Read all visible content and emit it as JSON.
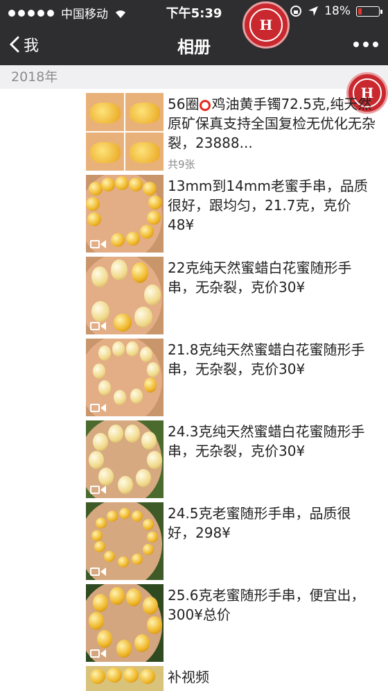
{
  "status": {
    "carrier": "中国移动",
    "time": "下午5:39",
    "battery": "18%",
    "battery_level": 0.18
  },
  "nav": {
    "back_label": "我",
    "title": "相册"
  },
  "logo_text": "H",
  "section": {
    "year": "2018年"
  },
  "entries": [
    {
      "text_a": "56圈",
      "text_b": "鸡油黄手镯72.5克,纯天然原矿保真支持全国复检无优化无杂裂，23888...",
      "count": "共9张"
    },
    {
      "text": "13mm到14mm老蜜手串，品质很好，跟均匀，21.7克，克价48¥"
    },
    {
      "text": "22克纯天然蜜蜡白花蜜随形手串，无杂裂，克价30¥"
    },
    {
      "text": "21.8克纯天然蜜蜡白花蜜随形手串，无杂裂，克价30¥"
    },
    {
      "text": "24.3克纯天然蜜蜡白花蜜随形手串，无杂裂，克价30¥"
    },
    {
      "text": "24.5克老蜜随形手串，品质很好，298¥"
    },
    {
      "text": "25.6克老蜜随形手串，便宜出，300¥总价"
    },
    {
      "text": "补视频"
    }
  ],
  "colors": {
    "bar": "#2e2e30",
    "section_bg": "#f0f0f2",
    "accent_red": "#e42a1e",
    "logo_red": "#c9282e"
  }
}
